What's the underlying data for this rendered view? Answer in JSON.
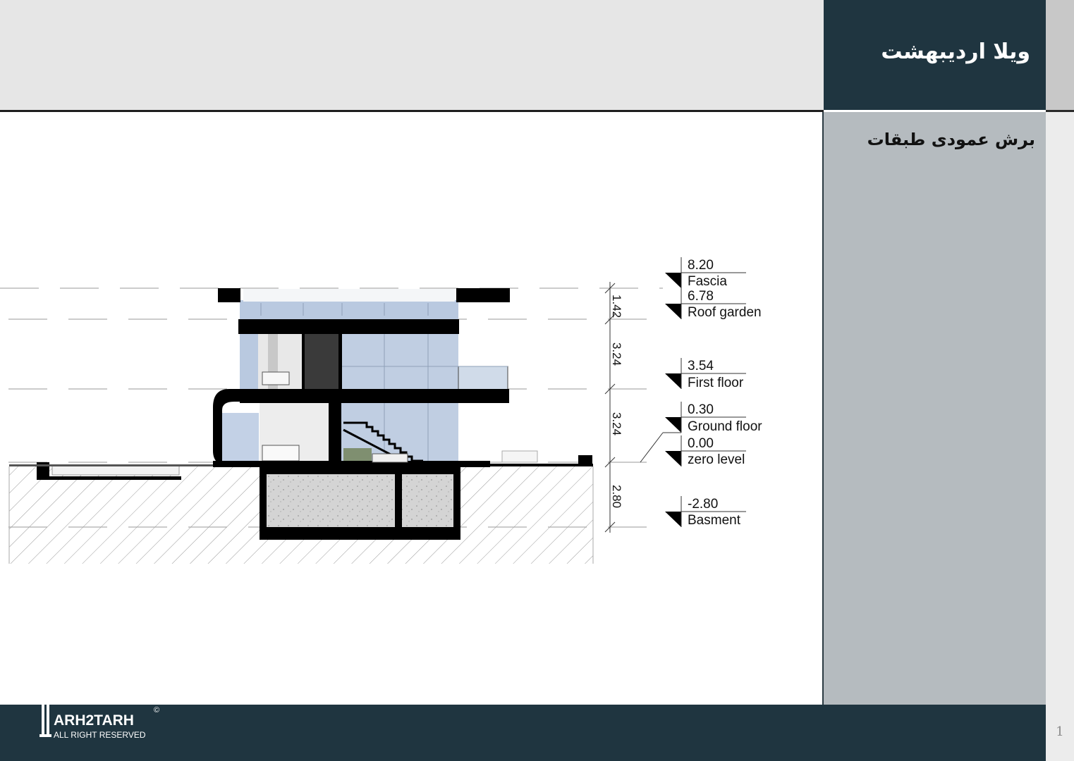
{
  "header": {
    "title": "ویلا اردیبهشت",
    "subtitle": "برش عمودی طبقات"
  },
  "drawing": {
    "levels": [
      {
        "elevation": "8.20",
        "name": "Fascia"
      },
      {
        "elevation": "6.78",
        "name": "Roof garden"
      },
      {
        "elevation": "3.54",
        "name": "First floor"
      },
      {
        "elevation": "0.30",
        "name": "Ground floor"
      },
      {
        "elevation": "0.00",
        "name": "zero level"
      },
      {
        "elevation": "-2.80",
        "name": "Basment"
      }
    ],
    "dimensions": [
      "1.42",
      "3.24",
      "3.24",
      "2.80"
    ]
  },
  "footer": {
    "brand": "ARH2TARH",
    "rights": "ALL RIGHT RESERVED",
    "copyright": "©",
    "page_number": "1"
  },
  "colors": {
    "dark_navy": "#1f3540",
    "panel_gray": "#b5bbbf",
    "header_gray": "#e6e6e6",
    "glass": "#b9c9e0"
  }
}
